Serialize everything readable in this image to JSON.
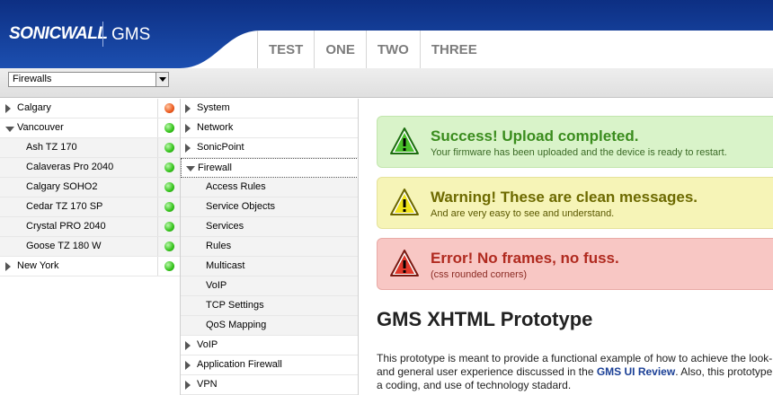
{
  "header": {
    "logo": "SONICWALL",
    "product": "GMS",
    "tabs": [
      "TEST",
      "ONE",
      "TWO",
      "THREE"
    ]
  },
  "toolbar": {
    "view_select": "Firewalls"
  },
  "devices": {
    "calgary": "Calgary",
    "vancouver": "Vancouver",
    "children": [
      "Ash TZ 170",
      "Calaveras Pro 2040",
      "Calgary SOHO2",
      "Cedar TZ 170 SP",
      "Crystal PRO 2040",
      "Goose TZ 180 W"
    ],
    "new_york": "New York"
  },
  "menu": {
    "system": "System",
    "network": "Network",
    "sonicpoint": "SonicPoint",
    "firewall": "Firewall",
    "firewall_items": [
      "Access Rules",
      "Service Objects",
      "Services",
      "Rules",
      "Multicast",
      "VoIP",
      "TCP Settings",
      "QoS Mapping"
    ],
    "voip": "VoIP",
    "app_firewall": "Application Firewall",
    "vpn": "VPN"
  },
  "messages": {
    "success_title": "Success! Upload completed.",
    "success_text": "Your firmware has been uploaded and the device is ready to restart.",
    "warning_title": "Warning! These are clean messages.",
    "warning_text": "And are very easy to see and understand.",
    "error_title": "Error! No frames, no fuss.",
    "error_text": "(css rounded corners)"
  },
  "content": {
    "heading": "GMS XHTML Prototype",
    "para_1": "This prototype is meant to provide a functional example of how to achieve the look-",
    "para_2a": "and general user experience discussed in the ",
    "para_link": "GMS UI Review",
    "para_2b": ". Also, this prototype",
    "para_3": "a coding, and use of technology stadard."
  },
  "colors": {
    "header_blue": "#1c4fb0",
    "status_green": "#34c21a",
    "status_red": "#ec5b1f"
  }
}
